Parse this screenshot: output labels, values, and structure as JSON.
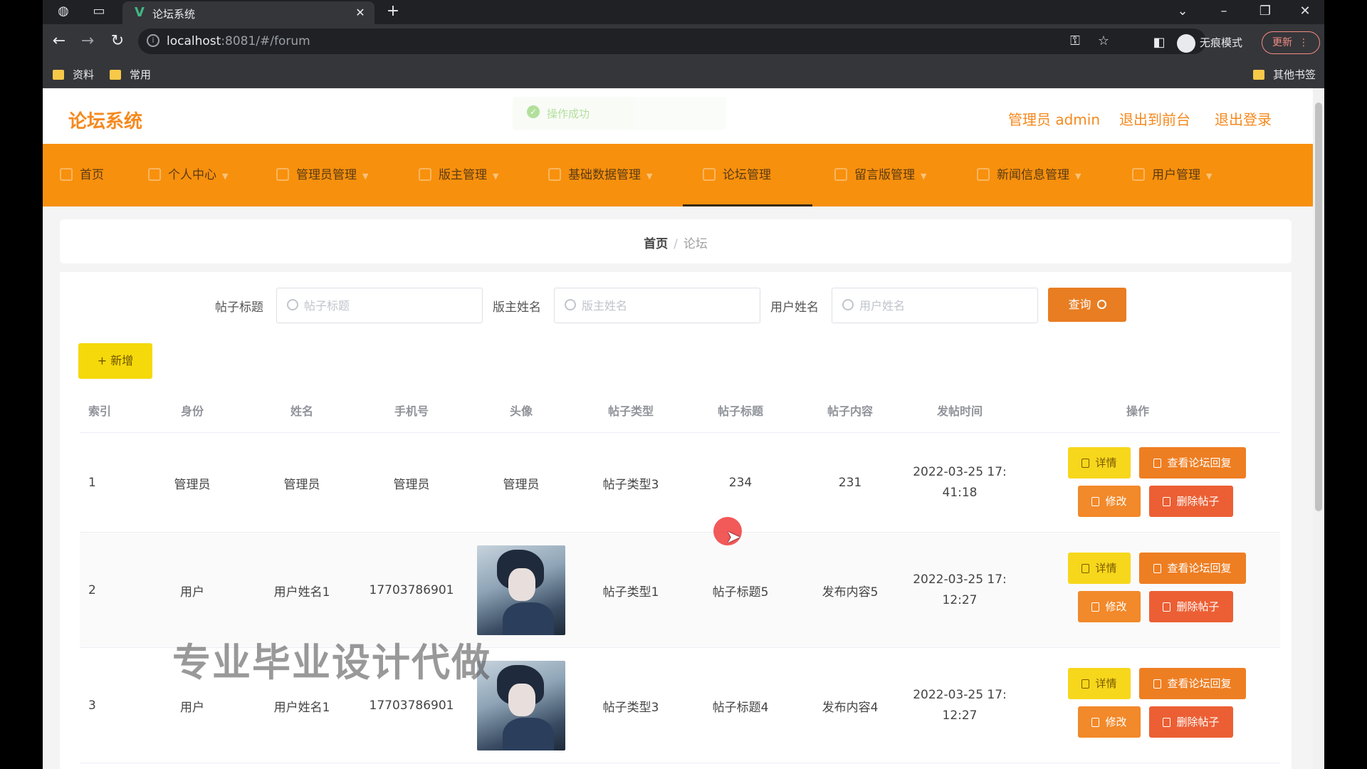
{
  "browser": {
    "tab_title": "论坛系统",
    "url_host": "localhost",
    "url_rest": ":8081/#/forum",
    "incognito_label": "无痕模式",
    "update_label": "更新",
    "bookmarks": [
      "资料",
      "常用"
    ],
    "other_bookmarks": "其他书签"
  },
  "header": {
    "logo": "论坛系统",
    "toast": "操作成功",
    "admin_label": "管理员 admin",
    "back_to_front": "退出到前台",
    "logout": "退出登录",
    "accent_color": "#f5891e"
  },
  "menu": {
    "items": [
      {
        "label": "首页"
      },
      {
        "label": "个人中心"
      },
      {
        "label": "管理员管理"
      },
      {
        "label": "版主管理"
      },
      {
        "label": "基础数据管理"
      },
      {
        "label": "论坛管理"
      },
      {
        "label": "留言版管理"
      },
      {
        "label": "新闻信息管理"
      },
      {
        "label": "用户管理"
      }
    ],
    "active": "论坛管理",
    "bg_color": "#f7900d"
  },
  "breadcrumb": {
    "home": "首页",
    "separator": "/",
    "current": "论坛"
  },
  "search": {
    "title_label": "帖子标题",
    "title_placeholder": "帖子标题",
    "moderator_label": "版主姓名",
    "moderator_placeholder": "版主姓名",
    "user_label": "用户姓名",
    "user_placeholder": "用户姓名",
    "query_label": "查询"
  },
  "add_label": "+ 新增",
  "table": {
    "headers": [
      "索引",
      "身份",
      "姓名",
      "手机号",
      "头像",
      "帖子类型",
      "帖子标题",
      "帖子内容",
      "发帖时间",
      "操作"
    ],
    "rows": [
      {
        "index": "1",
        "role": "管理员",
        "name": "管理员",
        "phone": "管理员",
        "avatar": "管理员",
        "type": "帖子类型3",
        "title": "234",
        "content": "231",
        "time_1": "2022-03-25 17:",
        "time_2": "41:18"
      },
      {
        "index": "2",
        "role": "用户",
        "name": "用户姓名1",
        "phone": "17703786901",
        "avatar": "",
        "type": "帖子类型1",
        "title": "帖子标题5",
        "content": "发布内容5",
        "time_1": "2022-03-25 17:",
        "time_2": "12:27"
      },
      {
        "index": "3",
        "role": "用户",
        "name": "用户姓名1",
        "phone": "17703786901",
        "avatar": "",
        "type": "帖子类型3",
        "title": "帖子标题4",
        "content": "发布内容4",
        "time_1": "2022-03-25 17:",
        "time_2": "12:27"
      }
    ],
    "ops": {
      "detail": "详情",
      "view_replies": "查看论坛回复",
      "edit": "修改",
      "delete": "删除帖子"
    }
  },
  "watermark": "专业毕业设计代做"
}
